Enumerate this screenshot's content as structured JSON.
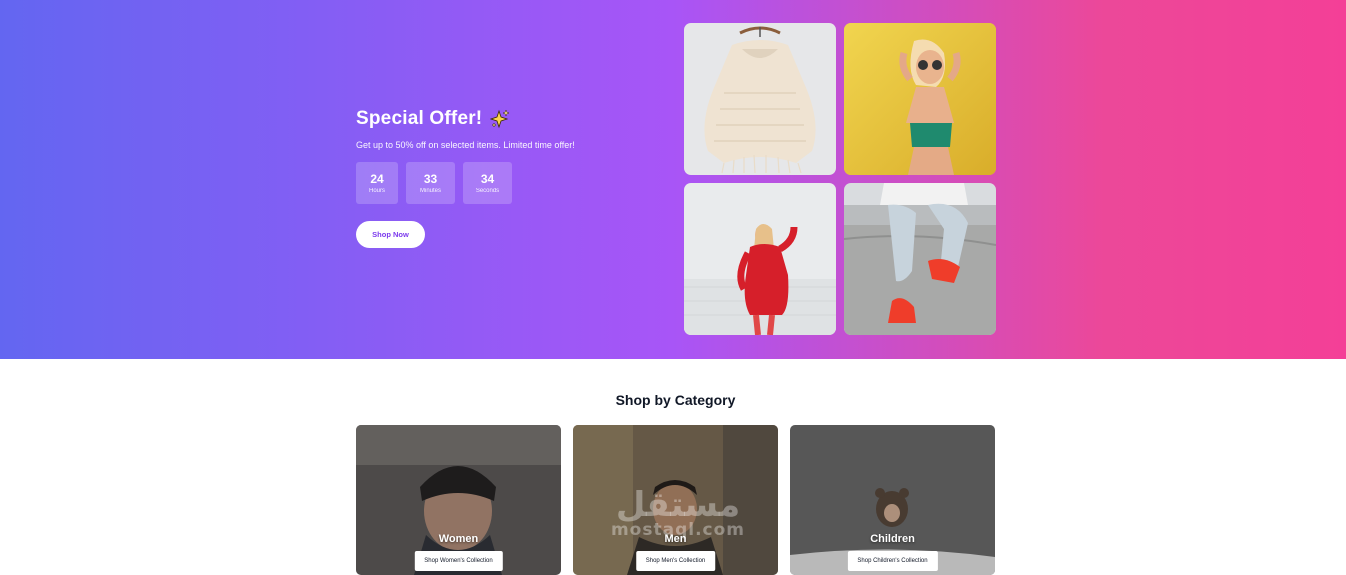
{
  "hero": {
    "title": "Special Offer!",
    "subtitle": "Get up to 50% off on selected items. Limited time offer!",
    "countdown": [
      {
        "value": "24",
        "label": "Hours"
      },
      {
        "value": "33",
        "label": "Minutes"
      },
      {
        "value": "34",
        "label": "Seconds"
      }
    ],
    "cta_label": "Shop Now",
    "gradient": [
      "#6366f1",
      "#a855f7",
      "#ec4899"
    ]
  },
  "categories": {
    "heading": "Shop by Category",
    "items": [
      {
        "title": "Women",
        "button": "Shop Women's Collection"
      },
      {
        "title": "Men",
        "button": "Shop Men's Collection"
      },
      {
        "title": "Children",
        "button": "Shop Children's Collection"
      }
    ]
  },
  "watermark": {
    "arabic": "مستقل",
    "latin": "mostaql.com"
  }
}
